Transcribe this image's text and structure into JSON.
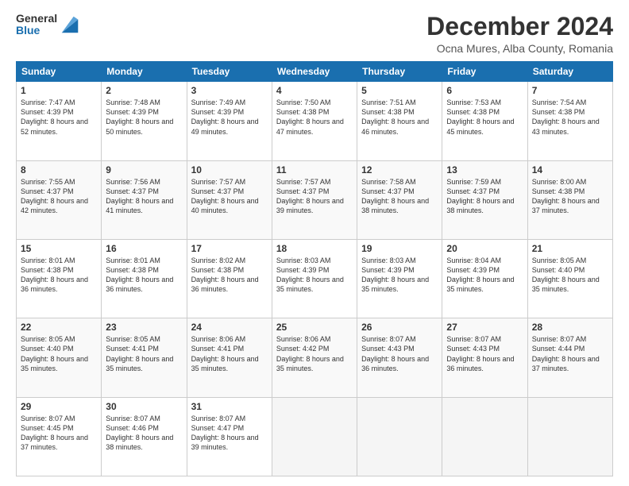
{
  "logo": {
    "general": "General",
    "blue": "Blue"
  },
  "title": "December 2024",
  "subtitle": "Ocna Mures, Alba County, Romania",
  "days_header": [
    "Sunday",
    "Monday",
    "Tuesday",
    "Wednesday",
    "Thursday",
    "Friday",
    "Saturday"
  ],
  "weeks": [
    [
      {
        "day": "1",
        "sunrise": "7:47 AM",
        "sunset": "4:39 PM",
        "daylight": "8 hours and 52 minutes."
      },
      {
        "day": "2",
        "sunrise": "7:48 AM",
        "sunset": "4:39 PM",
        "daylight": "8 hours and 50 minutes."
      },
      {
        "day": "3",
        "sunrise": "7:49 AM",
        "sunset": "4:39 PM",
        "daylight": "8 hours and 49 minutes."
      },
      {
        "day": "4",
        "sunrise": "7:50 AM",
        "sunset": "4:38 PM",
        "daylight": "8 hours and 47 minutes."
      },
      {
        "day": "5",
        "sunrise": "7:51 AM",
        "sunset": "4:38 PM",
        "daylight": "8 hours and 46 minutes."
      },
      {
        "day": "6",
        "sunrise": "7:53 AM",
        "sunset": "4:38 PM",
        "daylight": "8 hours and 45 minutes."
      },
      {
        "day": "7",
        "sunrise": "7:54 AM",
        "sunset": "4:38 PM",
        "daylight": "8 hours and 43 minutes."
      }
    ],
    [
      {
        "day": "8",
        "sunrise": "7:55 AM",
        "sunset": "4:37 PM",
        "daylight": "8 hours and 42 minutes."
      },
      {
        "day": "9",
        "sunrise": "7:56 AM",
        "sunset": "4:37 PM",
        "daylight": "8 hours and 41 minutes."
      },
      {
        "day": "10",
        "sunrise": "7:57 AM",
        "sunset": "4:37 PM",
        "daylight": "8 hours and 40 minutes."
      },
      {
        "day": "11",
        "sunrise": "7:57 AM",
        "sunset": "4:37 PM",
        "daylight": "8 hours and 39 minutes."
      },
      {
        "day": "12",
        "sunrise": "7:58 AM",
        "sunset": "4:37 PM",
        "daylight": "8 hours and 38 minutes."
      },
      {
        "day": "13",
        "sunrise": "7:59 AM",
        "sunset": "4:37 PM",
        "daylight": "8 hours and 38 minutes."
      },
      {
        "day": "14",
        "sunrise": "8:00 AM",
        "sunset": "4:38 PM",
        "daylight": "8 hours and 37 minutes."
      }
    ],
    [
      {
        "day": "15",
        "sunrise": "8:01 AM",
        "sunset": "4:38 PM",
        "daylight": "8 hours and 36 minutes."
      },
      {
        "day": "16",
        "sunrise": "8:01 AM",
        "sunset": "4:38 PM",
        "daylight": "8 hours and 36 minutes."
      },
      {
        "day": "17",
        "sunrise": "8:02 AM",
        "sunset": "4:38 PM",
        "daylight": "8 hours and 36 minutes."
      },
      {
        "day": "18",
        "sunrise": "8:03 AM",
        "sunset": "4:39 PM",
        "daylight": "8 hours and 35 minutes."
      },
      {
        "day": "19",
        "sunrise": "8:03 AM",
        "sunset": "4:39 PM",
        "daylight": "8 hours and 35 minutes."
      },
      {
        "day": "20",
        "sunrise": "8:04 AM",
        "sunset": "4:39 PM",
        "daylight": "8 hours and 35 minutes."
      },
      {
        "day": "21",
        "sunrise": "8:05 AM",
        "sunset": "4:40 PM",
        "daylight": "8 hours and 35 minutes."
      }
    ],
    [
      {
        "day": "22",
        "sunrise": "8:05 AM",
        "sunset": "4:40 PM",
        "daylight": "8 hours and 35 minutes."
      },
      {
        "day": "23",
        "sunrise": "8:05 AM",
        "sunset": "4:41 PM",
        "daylight": "8 hours and 35 minutes."
      },
      {
        "day": "24",
        "sunrise": "8:06 AM",
        "sunset": "4:41 PM",
        "daylight": "8 hours and 35 minutes."
      },
      {
        "day": "25",
        "sunrise": "8:06 AM",
        "sunset": "4:42 PM",
        "daylight": "8 hours and 35 minutes."
      },
      {
        "day": "26",
        "sunrise": "8:07 AM",
        "sunset": "4:43 PM",
        "daylight": "8 hours and 36 minutes."
      },
      {
        "day": "27",
        "sunrise": "8:07 AM",
        "sunset": "4:43 PM",
        "daylight": "8 hours and 36 minutes."
      },
      {
        "day": "28",
        "sunrise": "8:07 AM",
        "sunset": "4:44 PM",
        "daylight": "8 hours and 37 minutes."
      }
    ],
    [
      {
        "day": "29",
        "sunrise": "8:07 AM",
        "sunset": "4:45 PM",
        "daylight": "8 hours and 37 minutes."
      },
      {
        "day": "30",
        "sunrise": "8:07 AM",
        "sunset": "4:46 PM",
        "daylight": "8 hours and 38 minutes."
      },
      {
        "day": "31",
        "sunrise": "8:07 AM",
        "sunset": "4:47 PM",
        "daylight": "8 hours and 39 minutes."
      },
      null,
      null,
      null,
      null
    ]
  ]
}
